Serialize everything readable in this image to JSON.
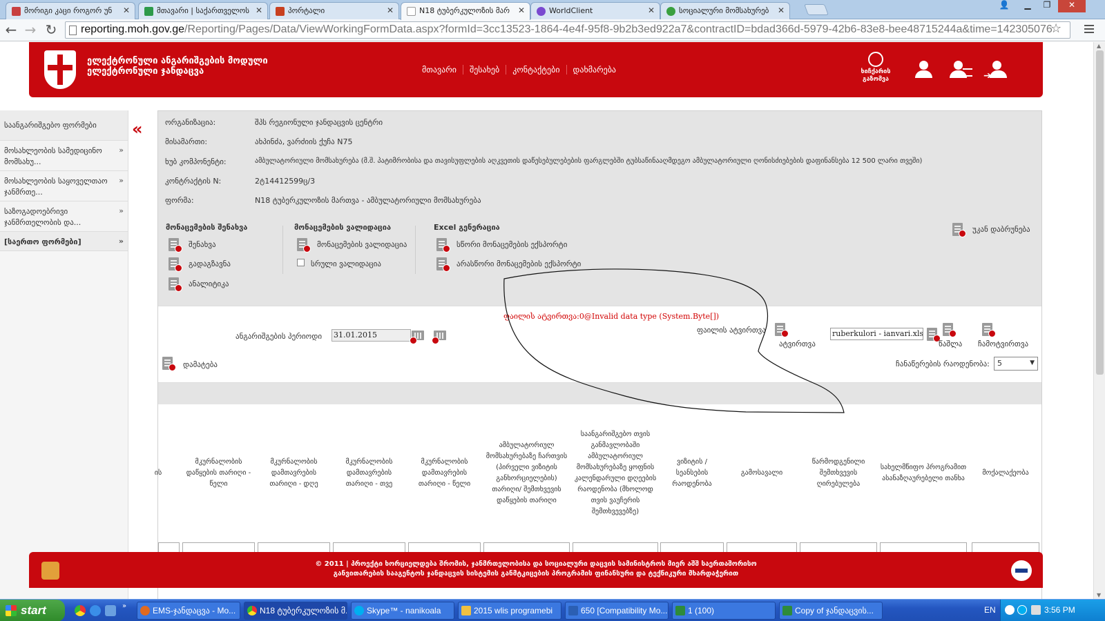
{
  "browser": {
    "tabs": [
      {
        "label": "მორიგი კაცი როგორ უნ",
        "color": "#c84040"
      },
      {
        "label": "მთავარი | საქართველოს",
        "color": "#2e9a4a"
      },
      {
        "label": "პორტალი",
        "color": "#c84020"
      },
      {
        "label": "N18 ტუბერკულოზის მარ",
        "color": "#ffffff"
      },
      {
        "label": "WorldClient",
        "color": "#7a4ad0"
      },
      {
        "label": "სოციალური მომსახურებ",
        "color": "#3aa040"
      }
    ],
    "url_host": "reporting.moh.gov.ge",
    "url_path": "/Reporting/Pages/Data/ViewWorkingFormData.aspx?formId=3cc13523-1864-4e4f-95f8-9b2b3ed922a7&contractID=bdad366d-5979-42b6-83e8-bee48715244a&time=142305076"
  },
  "header": {
    "brand_line1": "ელექტრონული ანგარიშგების მოდული",
    "brand_line2": "ელექტრონული ჯანდაცვა",
    "nav": [
      "მთავარი",
      "შესახებ",
      "კონტაქტები",
      "დახმარება"
    ],
    "speed_label_1": "ხიჩქარის",
    "speed_label_2": "გაზომვა"
  },
  "sidebar": {
    "title": "საანგარიშგებო ფორმები",
    "items": [
      {
        "label": "მოსახლეობის სამედიცინო მომსახუ..."
      },
      {
        "label": "მოსახლეობის საყოველთაო ჯანმრთე..."
      },
      {
        "label": "საზოგადოებრივი ჯანმრთელობის და..."
      },
      {
        "label": "[საერთო ფორმები]"
      }
    ]
  },
  "info": {
    "rows": [
      {
        "label": "ორგანიზაცია:",
        "value": "შპს რეგიონული ჯანდაცვის ცენტრი"
      },
      {
        "label": "მისამართი:",
        "value": "ახპინძა, ვარძიის ქუჩა N75"
      },
      {
        "label": "ხუბ კომპონენტი:",
        "value": "ამბულატორიული მომსახურება (მ.შ. პატიმრობისა და თავისუფლების აღკვეთის დაწესებულებების ფარგლებში ტუბსაწინააღმდეგო ამბულატორიული ღონისძიებების დაფინანსება 12 500 ლარი თვეში)"
      },
      {
        "label": "კონტრაქტის N:",
        "value": "2ტ14412599ც/3"
      },
      {
        "label": "ფორმა:",
        "value": "N18 ტუბერკულოზის მართვა - ამბულატორიული მომსახურება"
      }
    ]
  },
  "actions": {
    "group1_title": "მონაცემების შენახვა",
    "save": "შენახვა",
    "resend": "გადაგზავნა",
    "analytics": "ანალიტიკა",
    "group2_title": "მონაცემების ვალიდაცია",
    "validate": "მონაცემების ვალიდაცია",
    "full_validation": "სრული ვალიდაცია",
    "group3_title": "Excel გენერაცია",
    "export_correct": "სწორი მონაცემების ექსპორტი",
    "export_incorrect": "არასწორი მონაცემების ექსპორტი",
    "return": "უკან დაბრუნება"
  },
  "form": {
    "error_message": "ფაილის ატვირთვა:0@Invalid data type (System.Byte[])",
    "period_label": "ანგარიშგების პერიოდი",
    "period_value": "31.01.2015",
    "upload_label": "ფაილის ატვირთვა",
    "upload_button": "ატვირთვა",
    "file_name": "ruberkulori - ianvari.xls",
    "delete_button": "წაშლა",
    "import_button": "ჩამოტვირთვა",
    "add_button": "დამატება",
    "records_label": "ჩანაწერების რაოდენობა:",
    "records_value": "5"
  },
  "table": {
    "headers": [
      "ის",
      "მკურნალობის დაწყების თარიღი - წელი",
      "მკურნალობის დამთავრების თარიღი - დღე",
      "მკურნალობის დამთავრების თარიღი - თვე",
      "მკურნალობის დამთავრების თარიღი - წელი",
      "ამბულატორიულ მომსახურებაზე ჩართვის (პირველი ვიზიტის განხორციელების) თარიღი/ შემთხვევის დაწყების თარიღი",
      "საანგარიშგებო თვის განმავლობაში ამბულატორიულ მომსახურებაზე ყოფნის კალენდარული დღეების რაოდენობა (მხოლოდ თვის ვაუჩერის შემთხვევებზე)",
      "ვიზიტის / სეანსების რაოდენობა",
      "გამოსავალი",
      "წარმოდგენილი შემთხვევის ღირებულება",
      "სახელმწიფო პროგრამით ასანაზღაურებელი თანხა",
      "მოქალაქეობა"
    ]
  },
  "footer": {
    "line1": "© 2011 | პროექტი ხორციელდება შრომის, ჯანმრთელობისა და სოციალური დაცვის სამინისტროს მიერ აშშ საერთაშორისო",
    "line2": "განვითარების სააგენტოს ჯანდაცვის სისტემის განმტკიცების პროგრამის ფინანსური და ტექნიკური მხარდაჭერით"
  },
  "taskbar": {
    "start": "start",
    "tasks": [
      {
        "label": "EMS-ჯანდაცვა - Mo...",
        "color": "#e06a20"
      },
      {
        "label": "N18 ტუბერკულოზის მ...",
        "color": "#dd4422"
      },
      {
        "label": "Skype™ - nanikoala",
        "color": "#00aff0"
      },
      {
        "label": "2015 wlis programebi",
        "color": "#f0c040"
      },
      {
        "label": "650 [Compatibility Mo...",
        "color": "#2b5fb3"
      },
      {
        "label": "1 (100)",
        "color": "#2e8b3a"
      },
      {
        "label": "Copy of ჯანდაცვის...",
        "color": "#2e8b3a"
      }
    ],
    "lang": "EN",
    "time": "3:56 PM"
  }
}
